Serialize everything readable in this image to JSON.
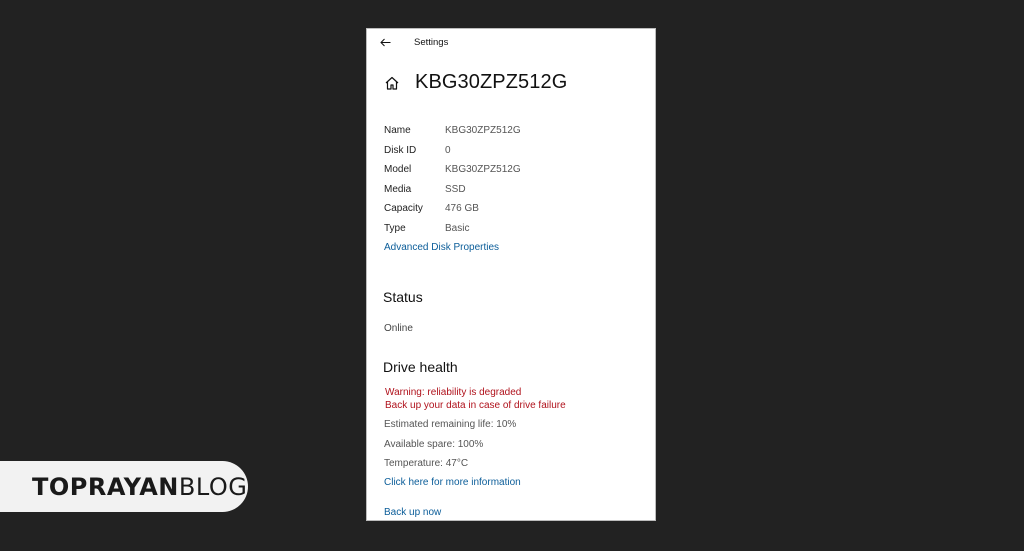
{
  "window": {
    "title": "Settings",
    "heading": "KBG30ZPZ512G"
  },
  "properties": [
    {
      "label": "Name",
      "value": "KBG30ZPZ512G"
    },
    {
      "label": "Disk ID",
      "value": "0"
    },
    {
      "label": "Model",
      "value": "KBG30ZPZ512G"
    },
    {
      "label": "Media",
      "value": "SSD"
    },
    {
      "label": "Capacity",
      "value": "476 GB"
    },
    {
      "label": "Type",
      "value": "Basic"
    }
  ],
  "advanced_link": "Advanced Disk Properties",
  "status": {
    "title": "Status",
    "value": "Online"
  },
  "health": {
    "title": "Drive health",
    "warning_line1": "Warning: reliability is degraded",
    "warning_line2": "Back up your data in case of drive failure",
    "remaining_life": "Estimated remaining life: 10%",
    "available_spare": "Available spare: 100%",
    "temperature": "Temperature: 47°C",
    "more_info_link": "Click here for more information",
    "backup_link": "Back up now"
  },
  "brand": {
    "bold": "TOPRAYAN",
    "light": "BLOG"
  },
  "icons": {
    "back": "arrow-left-icon",
    "home": "home-icon"
  },
  "colors": {
    "background": "#222222",
    "link": "#0b5d99",
    "warning": "#b0121c"
  }
}
